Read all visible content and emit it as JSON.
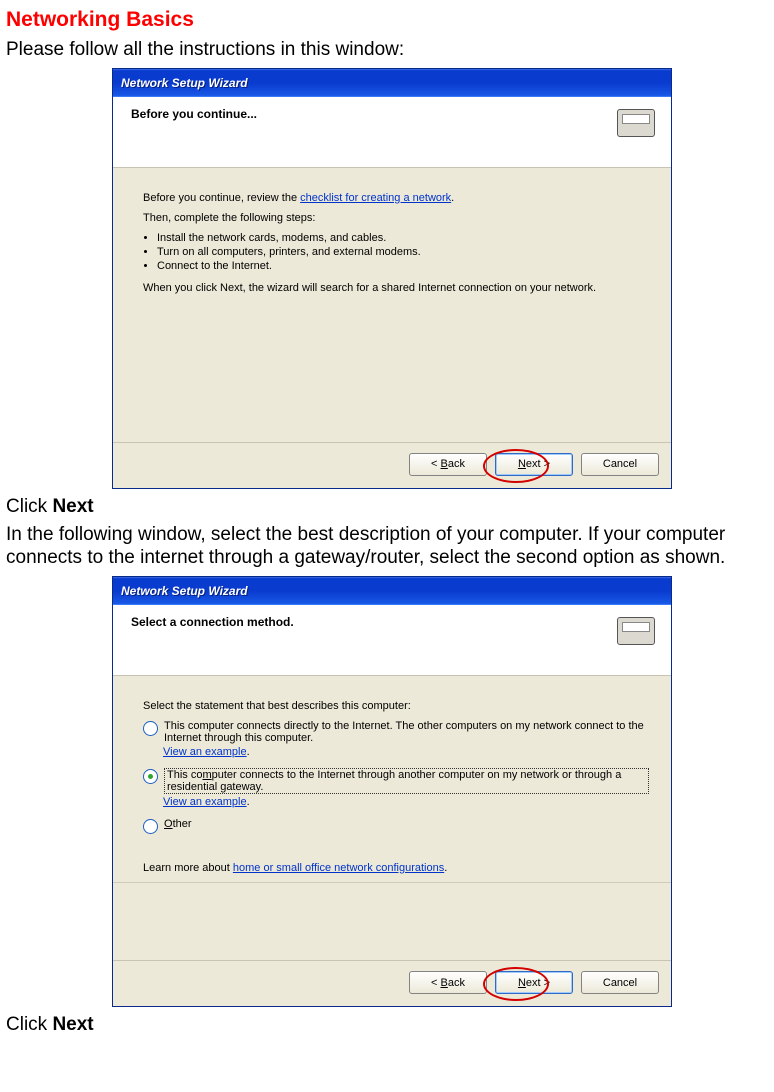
{
  "page": {
    "heading": "Networking Basics",
    "intro": "Please follow all the instructions in this window:",
    "click_next_1a": "Click ",
    "click_next_1b": "Next",
    "para2": "In the following window, select the best description of your computer.  If your computer connects to the internet through a gateway/router, select the second option as shown.",
    "click_next_2a": "Click ",
    "click_next_2b": "Next"
  },
  "wizard1": {
    "title": "Network Setup Wizard",
    "header": "Before you continue...",
    "p1a": "Before you continue, review the ",
    "p1_link": "checklist for creating a network",
    "p1b": ".",
    "p2": "Then, complete the following steps:",
    "bullets": [
      "Install the network cards, modems, and cables.",
      "Turn on all computers, printers, and external modems.",
      "Connect to the Internet."
    ],
    "p3": "When you click Next, the wizard will search for a shared Internet connection on your network.",
    "buttons": {
      "back_pre": "< ",
      "back_u": "B",
      "back_post": "ack",
      "next_u": "N",
      "next_post": "ext >",
      "cancel": "Cancel"
    }
  },
  "wizard2": {
    "title": "Network Setup Wizard",
    "header": "Select a connection method.",
    "prompt": "Select the statement that best describes this computer:",
    "opt1": "This computer connects directly to the Internet. The other computers on my network connect to the Internet through this computer.",
    "opt1_link": "View an example",
    "opt2_a": "This co",
    "opt2_u": "m",
    "opt2_b": "puter connects to the Internet through another computer on my network or through a residential gateway.",
    "opt2_link": "View an example",
    "opt3_u": "O",
    "opt3_post": "ther",
    "learn_a": "Learn more about ",
    "learn_link": "home or small office network configurations",
    "learn_b": ".",
    "buttons": {
      "back_pre": "< ",
      "back_u": "B",
      "back_post": "ack",
      "next_u": "N",
      "next_post": "ext >",
      "cancel": "Cancel"
    }
  }
}
